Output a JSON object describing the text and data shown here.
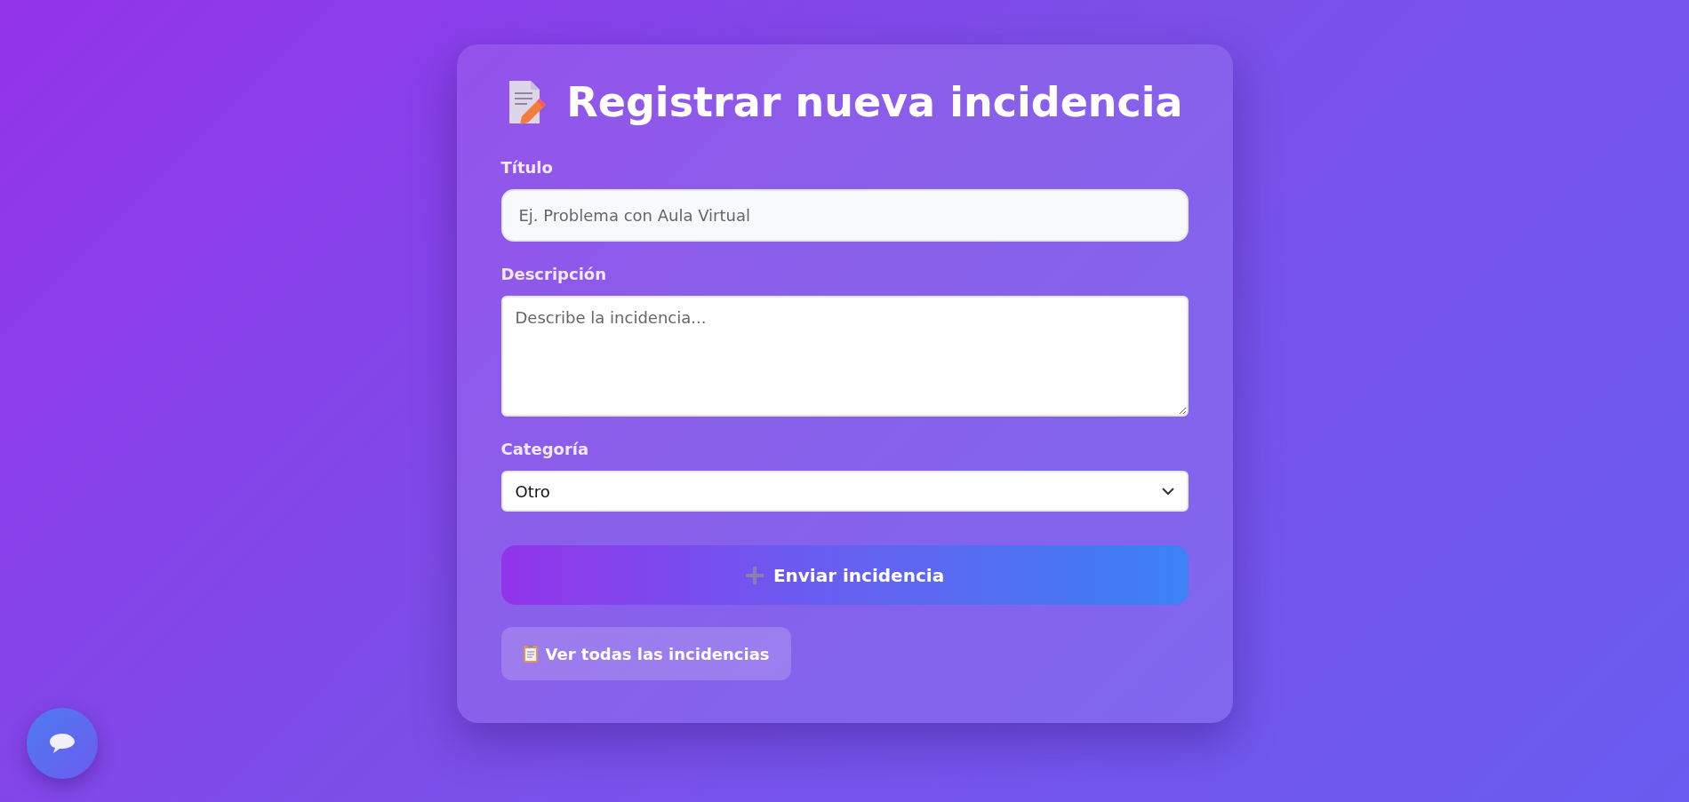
{
  "form": {
    "title": "Registrar nueva incidencia",
    "fields": [
      {
        "kind": "input",
        "label": "Título",
        "placeholder": "Ej. Problema con Aula Virtual"
      },
      {
        "kind": "textarea",
        "label": "Descripción",
        "placeholder": "Describe la incidencia..."
      },
      {
        "kind": "select",
        "label": "Categoría",
        "value": "Otro"
      }
    ],
    "submit_button": "Enviar incidencia",
    "list_button": "Ver todas las incidencias"
  }
}
